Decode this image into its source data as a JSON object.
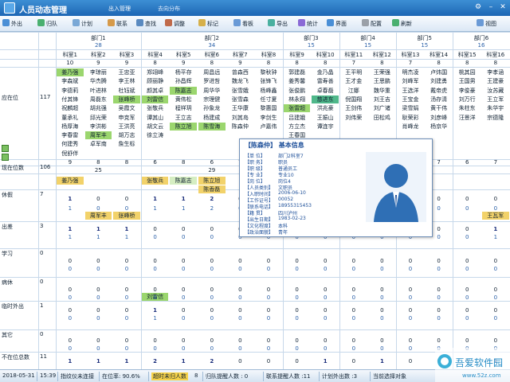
{
  "app": {
    "title": "人员动态管理",
    "tabs": [
      "出入管理",
      "去向分布"
    ],
    "window_buttons": [
      "⚙",
      "–",
      "✕"
    ]
  },
  "toolbar": {
    "items": [
      "外出",
      "归队",
      "计划",
      "联系",
      "查找",
      "调整",
      "标记",
      "看板",
      "导出",
      "统计",
      "界面",
      "配置",
      "刷新"
    ],
    "right": "视图"
  },
  "depts": [
    {
      "label": "部门1",
      "count": "28"
    },
    {
      "label": "部门2",
      "count": "34"
    },
    {
      "label": "部门3",
      "count": "15"
    },
    {
      "label": "部门4",
      "count": "15"
    },
    {
      "label": "部门5",
      "count": "15"
    },
    {
      "label": "部门6",
      "count": "16"
    }
  ],
  "rooms": [
    {
      "name": "科室1",
      "count": "10"
    },
    {
      "name": "科室2",
      "count": "9"
    },
    {
      "name": "科室3",
      "count": "9"
    },
    {
      "name": "科室4",
      "count": "8"
    },
    {
      "name": "科室5",
      "count": "9"
    },
    {
      "name": "科室6",
      "count": "8"
    },
    {
      "name": "科室7",
      "count": "9"
    },
    {
      "name": "科室8",
      "count": "8"
    },
    {
      "name": "科室9",
      "count": "8"
    },
    {
      "name": "科室10",
      "count": "8"
    },
    {
      "name": "科室11",
      "count": "7"
    },
    {
      "name": "科室12",
      "count": "8"
    },
    {
      "name": "科室13",
      "count": "7"
    },
    {
      "name": "科室14",
      "count": "8"
    },
    {
      "name": "科室15",
      "count": "8"
    },
    {
      "name": "科室16",
      "count": "8"
    }
  ],
  "names": [
    [
      "姜乃强",
      "李琼丽",
      "王忠亚",
      "郑翊峰",
      "杨平存",
      "周昌远",
      "曾森西",
      "黎秋钟",
      "郭建磊",
      "金乃晶",
      "王平明",
      "王荣强",
      "明杰凌",
      "卢炜国",
      "桃其园",
      "李孝涵"
    ],
    [
      "李森斌",
      "华杰腾",
      "李王林",
      "顾丽静",
      "孙昌辉",
      "罗进哲",
      "魏龙飞",
      "张锋飞",
      "姜秀馨",
      "雷寿善",
      "王才金",
      "王思鹏",
      "刘峰军",
      "刘建勇",
      "王国男",
      "王建豪"
    ],
    [
      "李德莉",
      "叶进林",
      "杜钰斌",
      "颜其卓",
      "陈嘉志",
      "周华华",
      "张雪娥",
      "杨峰鑫",
      "张俊鹏",
      "卓春磊",
      "江娜",
      "魏华重",
      "王选洋",
      "戴帝虎",
      "李俊豪",
      "汝苏藏"
    ],
    [
      "付其锋",
      "周磊东",
      "张峰桥",
      "刘雷信",
      "黄伟松",
      "宗理健",
      "张雪森",
      "任寸夏",
      "林永翔",
      "慈进东",
      "倪国翔",
      "刘王吉",
      "王宝金",
      "汤存清",
      "刘万行",
      "王立军"
    ],
    [
      "祝麟超",
      "胡兆强",
      "吴霞文",
      "张敬兵",
      "程祥玥",
      "孙象龙",
      "王华康",
      "黎惠国",
      "张雷超",
      "洪兆豪",
      "王剑伟",
      "刘广诸",
      "梁雪娟",
      "黄干伟",
      "朱柱东",
      "朱华宇"
    ],
    [
      "董承礼",
      "邱光荣",
      "申克军",
      "谭其山",
      "王立志",
      "杨建成",
      "刘其岛",
      "李剑生",
      "吕建娥",
      "王振山",
      "刘伟荣",
      "田松鸡",
      "耿荣彩",
      "刘彦峰",
      "汪景洋",
      "宗德隆"
    ],
    [
      "杨厚海",
      "李洪彬",
      "王洪亮",
      "胡文云",
      "陈立旭",
      "陈雪海",
      "陈森仲",
      "卢嘉伟",
      "方立杰",
      "谭连宇",
      "",
      "",
      "肖峰龙",
      "杨京华",
      "",
      ""
    ],
    [
      "李春雷",
      "周军丰",
      "胡万志",
      "徐立涛",
      "",
      "",
      "",
      "",
      "王春国",
      "",
      "",
      "",
      "",
      "",
      "",
      ""
    ],
    [
      "何建秀",
      "卓军南",
      "詹生标",
      "",
      "",
      "",
      "",
      "",
      "",
      "",
      "",
      "",
      "",
      "",
      "",
      ""
    ],
    [
      "倪舒伴",
      "",
      "",
      "",
      "",
      "",
      "",
      "",
      "",
      "",
      "",
      "",
      "",
      "",
      "",
      ""
    ]
  ],
  "highlighted": [
    {
      "col": 0,
      "row": 0,
      "color": "#9bd66e"
    },
    {
      "col": 3,
      "row": 3,
      "color": "#9bd66e"
    },
    {
      "col": 2,
      "row": 3,
      "color": "#9bd66e"
    },
    {
      "col": 4,
      "row": 2,
      "color": "#9bd66e"
    },
    {
      "col": 5,
      "row": 6,
      "color": "#9bd66e"
    },
    {
      "col": 4,
      "row": 6,
      "color": "#9bd66e"
    },
    {
      "col": 9,
      "row": 3,
      "color": "#4fb88a"
    },
    {
      "col": 1,
      "row": 7,
      "color": "#9bd66e"
    },
    {
      "col": 8,
      "row": 4,
      "color": "#9bd66e"
    }
  ],
  "summary": {
    "on_duty_label": "应在位",
    "on_duty_count": "117",
    "present_label": "现在位数",
    "present_count": "106"
  },
  "present_row": [
    "9",
    "8",
    "8",
    "6",
    "8",
    "6",
    "7",
    "8",
    "8",
    "7",
    "5",
    "7",
    "7",
    "7",
    "6",
    "7"
  ],
  "section_count": [
    "",
    "25",
    "",
    "",
    "",
    "29",
    "",
    "",
    "",
    "",
    "",
    "",
    "",
    "",
    "",
    ""
  ],
  "categories": [
    {
      "label": "休假",
      "count": "7"
    },
    {
      "label": "出差",
      "count": "3"
    },
    {
      "label": "学习",
      "count": "0"
    },
    {
      "label": "病休",
      "count": "0"
    },
    {
      "label": "临时外出",
      "count": "1"
    },
    {
      "label": "其它",
      "count": "0"
    },
    {
      "label": "不在位总数",
      "count": "11"
    }
  ],
  "leave_names": [
    {
      "col": 0,
      "text": "姜乃强",
      "color": "#f2d26a"
    },
    {
      "col": 3,
      "text": "张敬兵",
      "color": "#f2d26a"
    },
    {
      "col": 4,
      "text": "陈嘉志",
      "color": "#d5eec2"
    },
    {
      "col": 5,
      "text": "陈立旭",
      "color": "#f2d26a"
    },
    {
      "col": 5,
      "text": "陈香磊",
      "color": "#f2d26a"
    }
  ],
  "trip_names": [
    {
      "col": 1,
      "text": "周军丰",
      "color": "#f2d26a"
    },
    {
      "col": 2,
      "text": "张峰桥",
      "color": "#f2d26a"
    },
    {
      "col": 15,
      "text": "王瓦军",
      "color": "#f2d26a"
    }
  ],
  "temp_names": [
    {
      "col": 3,
      "text": "刘雷信",
      "color": "#9bd66e"
    }
  ],
  "count_rows": [
    [
      "1",
      "0",
      "0",
      "1",
      "1",
      "2",
      "0",
      "0",
      "0",
      "0",
      "0",
      "0",
      "0",
      "0",
      "0",
      "0"
    ],
    [
      "1",
      "1",
      "1",
      "0",
      "0",
      "0",
      "0",
      "0",
      "0",
      "0",
      "0",
      "0",
      "0",
      "0",
      "0",
      "1"
    ],
    [
      "0",
      "0",
      "0",
      "0",
      "0",
      "0",
      "0",
      "0",
      "0",
      "0",
      "0",
      "0",
      "0",
      "0",
      "0",
      "0"
    ],
    [
      "0",
      "0",
      "0",
      "0",
      "0",
      "0",
      "0",
      "0",
      "0",
      "0",
      "0",
      "0",
      "0",
      "0",
      "0",
      "0"
    ],
    [
      "0",
      "0",
      "0",
      "1",
      "0",
      "0",
      "0",
      "0",
      "0",
      "0",
      "0",
      "0",
      "0",
      "0",
      "0",
      "0"
    ],
    [
      "0",
      "0",
      "0",
      "0",
      "0",
      "0",
      "0",
      "0",
      "0",
      "0",
      "0",
      "0",
      "0",
      "0",
      "0",
      "0"
    ],
    [
      "1",
      "1",
      "1",
      "2",
      "1",
      "2",
      "0",
      "0",
      "0",
      "1",
      "0",
      "1",
      "0",
      "0",
      "0",
      "1"
    ]
  ],
  "popup": {
    "title": "【陈森仲】  基本信息",
    "fields": [
      {
        "label": "【单   位】",
        "value": "部门2科室7"
      },
      {
        "label": "【职   务】",
        "value": "职员"
      },
      {
        "label": "【职   级】",
        "value": "普通员工"
      },
      {
        "label": "【专   业】",
        "value": "专业10"
      },
      {
        "label": "【岗   位】",
        "value": "岗位4"
      },
      {
        "label": "【人员类别】",
        "value": "文职员"
      },
      {
        "label": "【入职时间】",
        "value": "2006-06-10"
      },
      {
        "label": "【工作证号】",
        "value": "00052"
      },
      {
        "label": "【联系电话】",
        "value": "18955315453"
      },
      {
        "label": "【籍   贯】",
        "value": "四川泸州"
      },
      {
        "label": "【出生日期】",
        "value": "1983-02-23"
      },
      {
        "label": "【文化程度】",
        "value": "本科"
      },
      {
        "label": "【政治面貌】",
        "value": "青年"
      }
    ]
  },
  "status": {
    "date": "2018-05-31",
    "time": "15:39",
    "device": "指纹仪未连接",
    "rate": "在位率: 90.6%",
    "overdue": "超时未归人数",
    "overdue_count": "8",
    "unreturned": "归队提醒人数 : 0",
    "contact": "联系提醒人数 :11",
    "plan": "计划外出数 :3",
    "selected": "当前选择对象"
  },
  "watermark": {
    "text": "吾爱软件园",
    "url": "www.52z.com"
  },
  "colors": {
    "titlebar": "#1d66b4",
    "highlight_green": "#9bd66e",
    "highlight_yellow": "#f2d26a",
    "teal": "#4fb88a"
  }
}
